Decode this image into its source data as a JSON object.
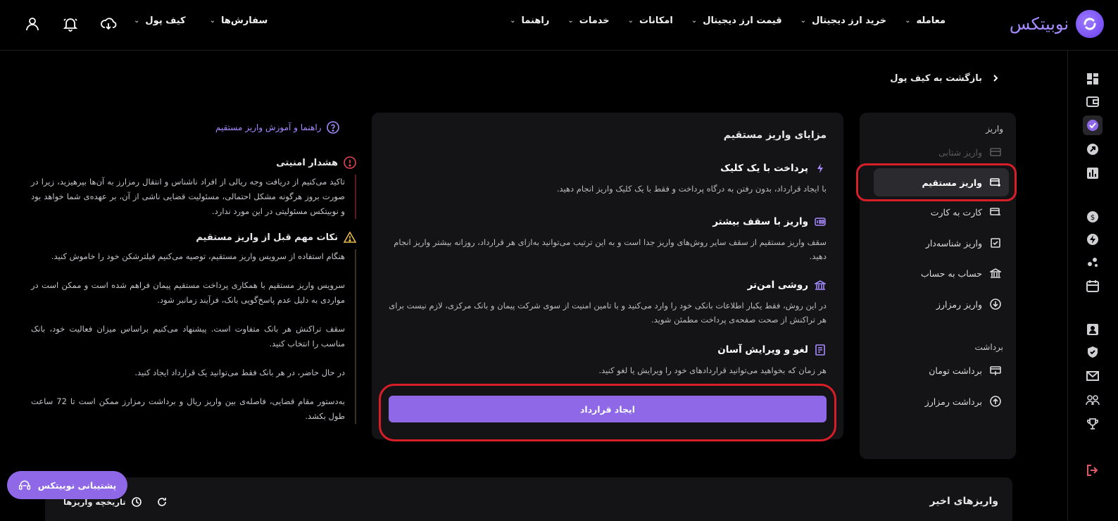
{
  "brand": {
    "name": "نوبیتکس"
  },
  "nav": {
    "items": [
      "معامله",
      "خرید ارز دیجیتال",
      "قیمت ارز دیجیتال",
      "امکانات",
      "خدمات",
      "راهنما"
    ],
    "orders": "سفارش‌ها",
    "wallet": "کیف پول"
  },
  "breadcrumb": {
    "back": "بازگشت به کیف پول"
  },
  "sidebar": {
    "deposit_head": "واریز",
    "withdraw_head": "برداشت",
    "deposit_items": [
      {
        "label": "واریز شتابی"
      },
      {
        "label": "واریز مستقیم"
      },
      {
        "label": "کارت به کارت"
      },
      {
        "label": "واریز شناسه‌دار"
      },
      {
        "label": "حساب به حساب"
      },
      {
        "label": "واریز رمزارز"
      }
    ],
    "withdraw_items": [
      {
        "label": "برداشت تومان"
      },
      {
        "label": "برداشت رمزارز"
      }
    ]
  },
  "card": {
    "title": "مزایای واریز مستقیم",
    "features": [
      {
        "title": "پرداخت با یک کلیک",
        "desc": "با ایجاد قرارداد، بدون رفتن به درگاه پرداخت و فقط با یک کلیک واریز انجام دهید."
      },
      {
        "title": "واریز با سقف بیشتر",
        "desc": "سقف واریز مستقیم از سقف سایر روش‌های واریز جدا است و به این ترتیب می‌توانید به‌ازای هر قرارداد، روزانه بیشتر واریز انجام دهید."
      },
      {
        "title": "روشی امن‌تر",
        "desc": "در این روش، فقط یکبار اطلاعات بانکی خود را وارد می‌کنید و با تامین امنیت از سوی شرکت پیمان و بانک مرکزی، لازم نیست برای هر تراکنش از صحت صفحه‌ی پرداخت مطمئن شوید."
      },
      {
        "title": "لغو و ویرایش آسان",
        "desc": "هر زمان که بخواهید می‌توانید قراردادهای خود را ویرایش یا لغو کنید."
      }
    ],
    "cta": "ایجاد قرارداد"
  },
  "guide": {
    "link": "راهنما و آموزش واریز مستقیم",
    "warning_title": "هشدار امنیتی",
    "warning_body": "تاکید می‌کنیم از دریافت وجه ریالی از افراد ناشناس و انتقال رمزارز به آن‌ها بپرهیزید، زیرا در صورت بروز هرگونه مشکل احتمالی، مسئولیت قضایی ناشی از آن، بر عهده‌ی شما خواهد بود و نوبیتکس مسئولیتی در این مورد ندارد.",
    "tips_title": "نکات مهم قبل از واریز مستقیم",
    "tips": [
      "هنگام استفاده از سرویس واریز مستقیم، توصیه می‌کنیم فیلترشکن خود را خاموش کنید.",
      "سرویس واریز مستقیم با همکاری پرداخت مستقیم پیمان فراهم شده است و ممکن است در مواردی به دلیل عدم پاسخ‌گویی بانک، فرآیند زمانبر شود.",
      "سقف تراکنش هر بانک متفاوت است. پیشنهاد می‌کنیم براساس میزان فعالیت خود، بانک مناسب را انتخاب کنید.",
      "در حال حاضر، در هر بانک فقط می‌توانید یک قرارداد ایجاد کنید.",
      "به‌دستور مقام قضایی، فاصله‌ی بین واریز ریال و برداشت رمزارز ممکن است تا 72 ساعت طول بکشد."
    ]
  },
  "recent": {
    "title": "واریزهای اخیر",
    "history": "تاریخچه واریزها"
  },
  "support": {
    "label": "پشتیبانی نوبیتکس"
  },
  "colors": {
    "accent": "#8f68e8",
    "highlight_ring": "#d81e28",
    "panel": "#141416"
  }
}
